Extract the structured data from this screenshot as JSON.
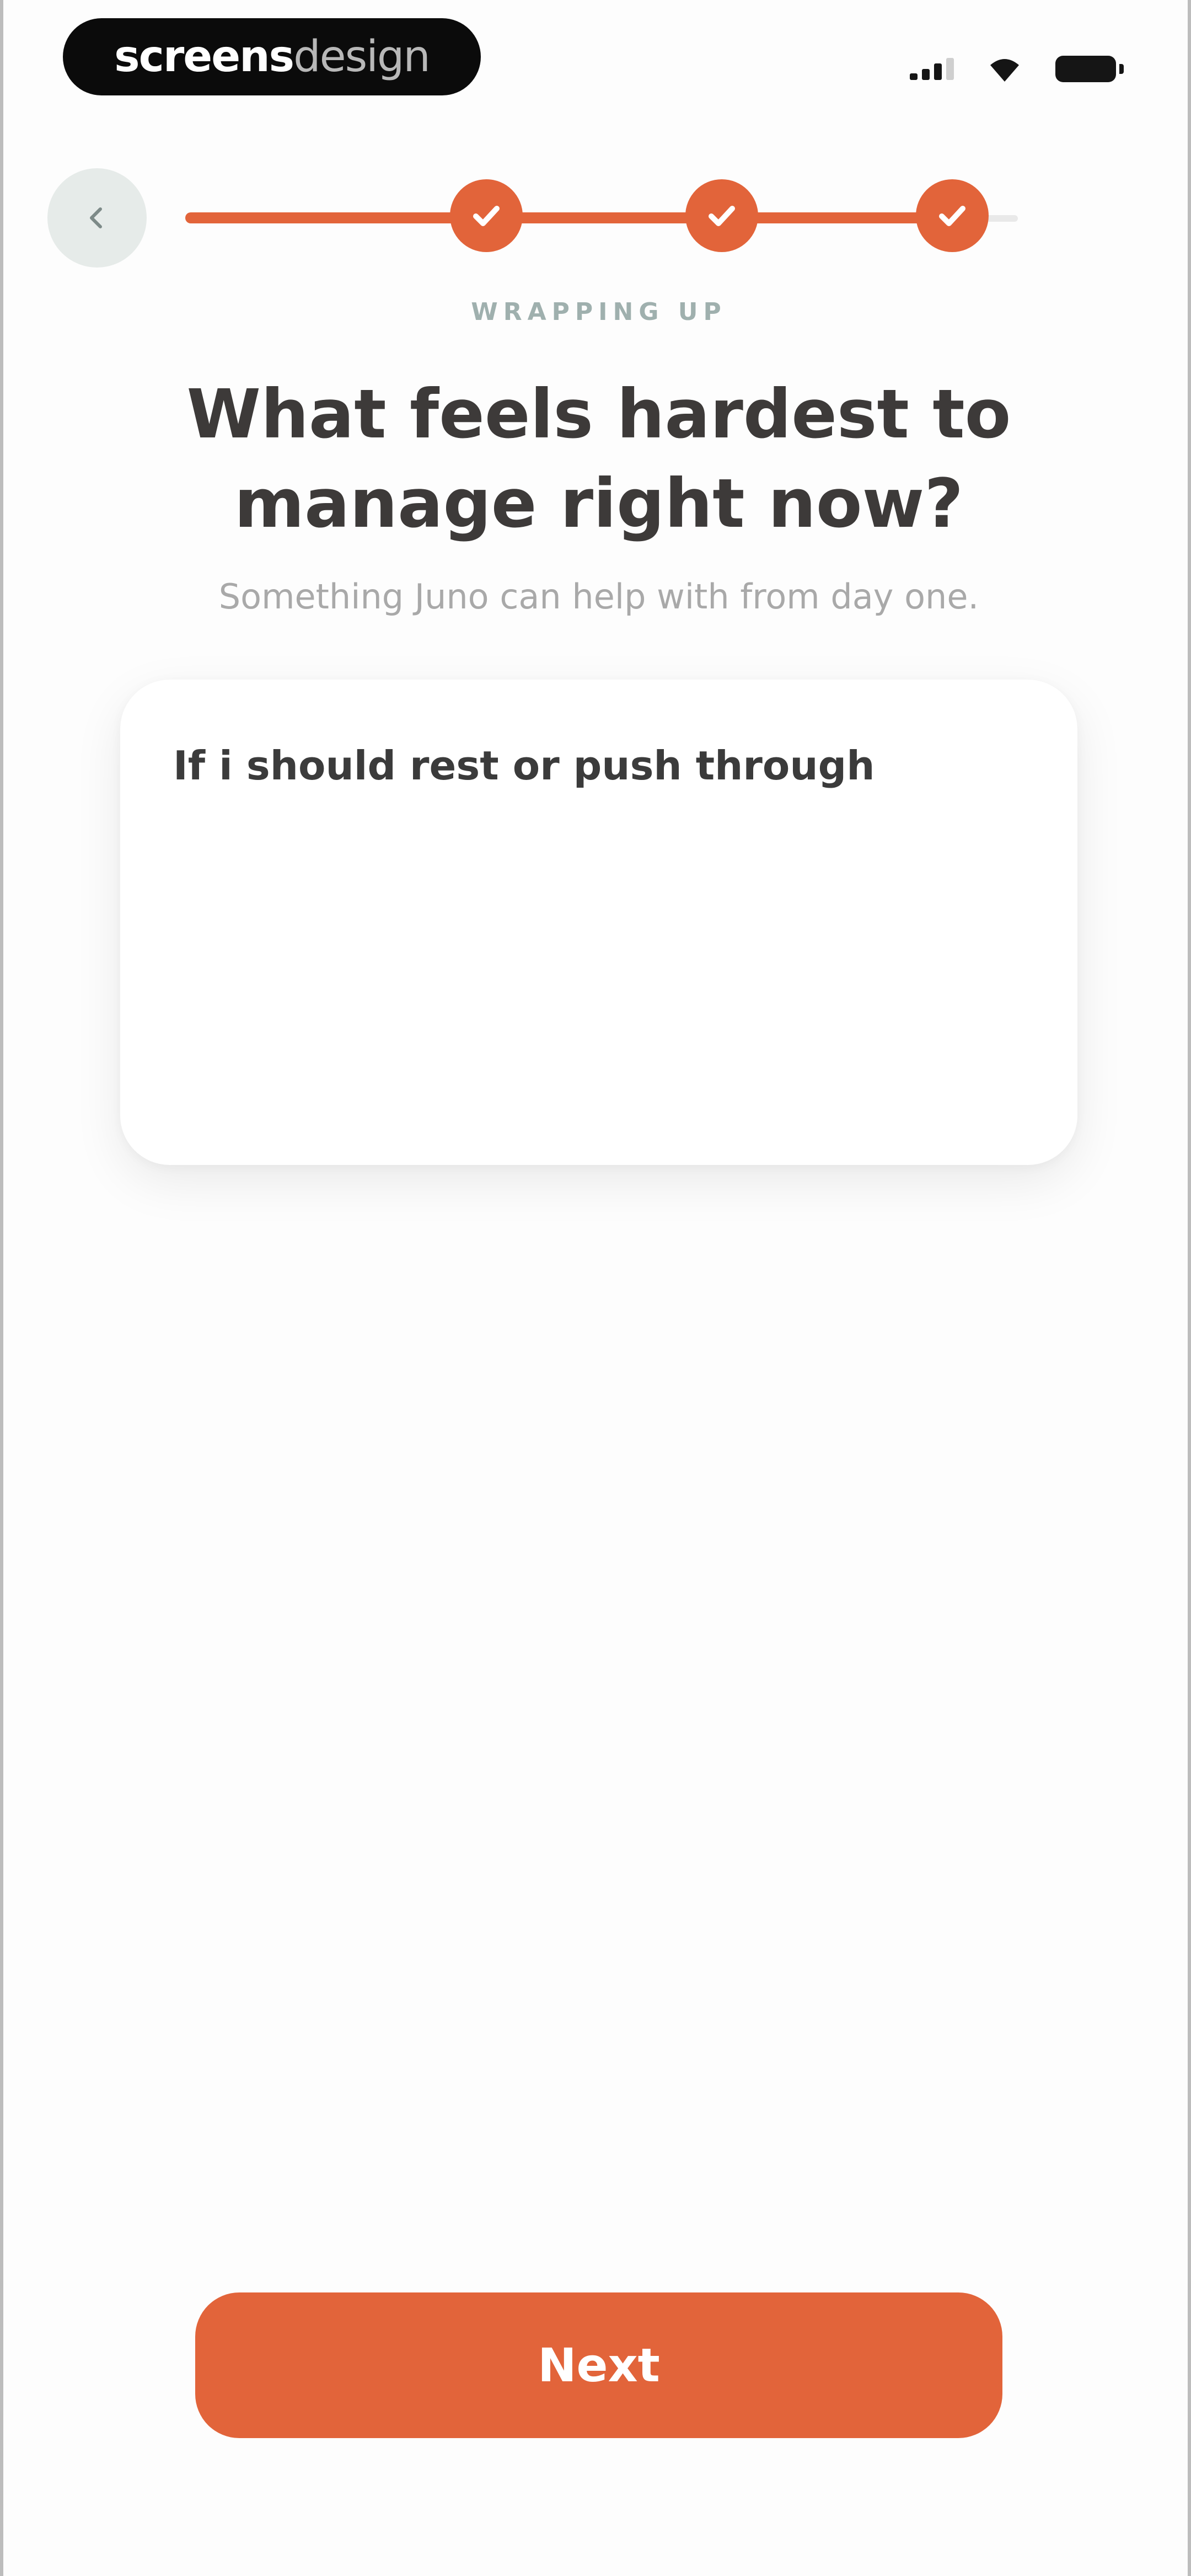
{
  "status_bar": {
    "brand_part1": "screens",
    "brand_part2": "design"
  },
  "header": {
    "back_icon": "chevron-left-icon",
    "progress": {
      "completed_steps": 3,
      "total_steps": 3,
      "step_icon": "check-icon"
    },
    "eyebrow": "WRAPPING UP"
  },
  "question": {
    "title": "What feels hardest to manage right now?",
    "subtitle": "Something Juno can help with from day one."
  },
  "answer": {
    "value": "If i should rest or push through"
  },
  "footer": {
    "next_label": "Next"
  },
  "colors": {
    "accent": "#e2643a",
    "back_button_bg": "#e6ebe9",
    "eyebrow": "#9fb0ae"
  }
}
